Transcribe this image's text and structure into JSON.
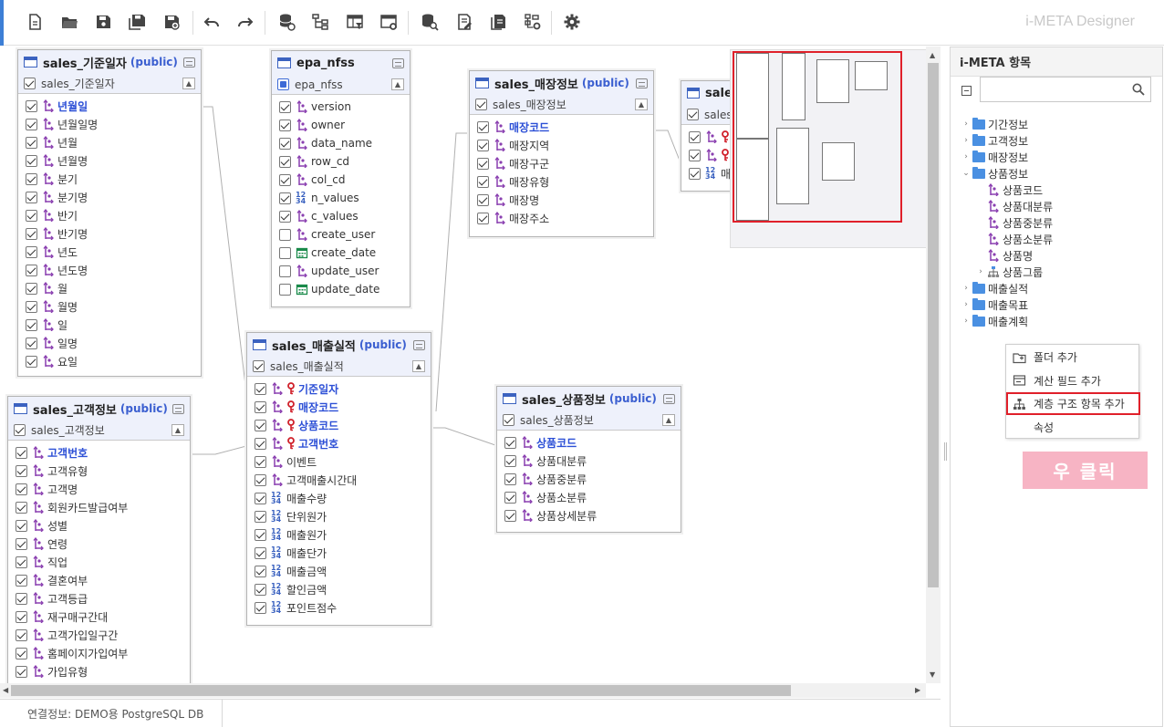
{
  "app": {
    "brand": "i-META Designer"
  },
  "toolbar": {
    "buttons": [
      {
        "name": "new-document",
        "icon": "new-document-icon"
      },
      {
        "name": "open-folder",
        "icon": "folder-open-icon"
      },
      {
        "name": "save",
        "icon": "save-icon"
      },
      {
        "name": "save-all",
        "icon": "save-all-icon"
      },
      {
        "name": "save-as",
        "icon": "save-as-icon"
      },
      {
        "name": "undo",
        "icon": "undo-icon"
      },
      {
        "name": "redo",
        "icon": "redo-icon"
      },
      {
        "name": "database-connect",
        "icon": "database-link-icon"
      },
      {
        "name": "hierarchy",
        "icon": "hierarchy-icon"
      },
      {
        "name": "table-filter",
        "icon": "table-filter-icon"
      },
      {
        "name": "table-settings",
        "icon": "table-settings-icon"
      },
      {
        "name": "database-search",
        "icon": "database-search-icon"
      },
      {
        "name": "document-edit",
        "icon": "document-edit-icon"
      },
      {
        "name": "document-copy",
        "icon": "document-copy-icon"
      },
      {
        "name": "tree-settings",
        "icon": "tree-settings-icon"
      },
      {
        "name": "settings",
        "icon": "gear-icon"
      }
    ]
  },
  "tables": {
    "date": {
      "name": "sales_기준일자",
      "schema": "(public)",
      "alias": "sales_기준일자",
      "fields": [
        {
          "label": "년월일",
          "type": "dim",
          "pk": true,
          "checked": true
        },
        {
          "label": "년월일명",
          "type": "dim",
          "checked": true
        },
        {
          "label": "년월",
          "type": "dim",
          "checked": true
        },
        {
          "label": "년월명",
          "type": "dim",
          "checked": true
        },
        {
          "label": "분기",
          "type": "dim",
          "checked": true
        },
        {
          "label": "분기명",
          "type": "dim",
          "checked": true
        },
        {
          "label": "반기",
          "type": "dim",
          "checked": true
        },
        {
          "label": "반기명",
          "type": "dim",
          "checked": true
        },
        {
          "label": "년도",
          "type": "dim",
          "checked": true
        },
        {
          "label": "년도명",
          "type": "dim",
          "checked": true
        },
        {
          "label": "월",
          "type": "dim",
          "checked": true
        },
        {
          "label": "월명",
          "type": "dim",
          "checked": true
        },
        {
          "label": "일",
          "type": "dim",
          "checked": true
        },
        {
          "label": "일명",
          "type": "dim",
          "checked": true
        },
        {
          "label": "요일",
          "type": "dim",
          "checked": true
        }
      ]
    },
    "nfss": {
      "name": "epa_nfss",
      "schema": "",
      "alias": "epa_nfss",
      "fields": [
        {
          "label": "version",
          "type": "dim",
          "checked": true
        },
        {
          "label": "owner",
          "type": "dim",
          "checked": true
        },
        {
          "label": "data_name",
          "type": "dim",
          "checked": true
        },
        {
          "label": "row_cd",
          "type": "dim",
          "checked": true
        },
        {
          "label": "col_cd",
          "type": "dim",
          "checked": true
        },
        {
          "label": "n_values",
          "type": "num",
          "checked": true
        },
        {
          "label": "c_values",
          "type": "dim",
          "checked": true
        },
        {
          "label": "create_user",
          "type": "dim",
          "checked": false
        },
        {
          "label": "create_date",
          "type": "date",
          "checked": false
        },
        {
          "label": "update_user",
          "type": "dim",
          "checked": false
        },
        {
          "label": "update_date",
          "type": "date",
          "checked": false
        }
      ]
    },
    "store": {
      "name": "sales_매장정보",
      "schema": "(public)",
      "alias": "sales_매장정보",
      "fields": [
        {
          "label": "매장코드",
          "type": "dim",
          "pk": true,
          "checked": true
        },
        {
          "label": "매장지역",
          "type": "dim",
          "checked": true
        },
        {
          "label": "매장구군",
          "type": "dim",
          "checked": true
        },
        {
          "label": "매장유형",
          "type": "dim",
          "checked": true
        },
        {
          "label": "매장명",
          "type": "dim",
          "checked": true
        },
        {
          "label": "매장주소",
          "type": "dim",
          "checked": true
        }
      ]
    },
    "partial": {
      "name": "sale",
      "alias": "sales",
      "fields": [
        {
          "label": "",
          "type": "dim",
          "key": true,
          "checked": true
        },
        {
          "label": "",
          "type": "dim",
          "key": true,
          "checked": true
        },
        {
          "label": "매",
          "type": "num",
          "checked": true
        }
      ]
    },
    "sales": {
      "name": "sales_매출실적",
      "schema": "(public)",
      "alias": "sales_매출실적",
      "fields": [
        {
          "label": "기준일자",
          "type": "dim",
          "key": true,
          "pk": true,
          "checked": true
        },
        {
          "label": "매장코드",
          "type": "dim",
          "key": true,
          "pk": true,
          "checked": true
        },
        {
          "label": "상품코드",
          "type": "dim",
          "key": true,
          "pk": true,
          "checked": true
        },
        {
          "label": "고객번호",
          "type": "dim",
          "key": true,
          "pk": true,
          "checked": true
        },
        {
          "label": "이벤트",
          "type": "dim",
          "checked": true
        },
        {
          "label": "고객매출시간대",
          "type": "dim",
          "checked": true
        },
        {
          "label": "매출수량",
          "type": "num",
          "checked": true
        },
        {
          "label": "단위원가",
          "type": "num",
          "checked": true
        },
        {
          "label": "매출원가",
          "type": "num",
          "checked": true
        },
        {
          "label": "매출단가",
          "type": "num",
          "checked": true
        },
        {
          "label": "매출금액",
          "type": "num",
          "checked": true
        },
        {
          "label": "할인금액",
          "type": "num",
          "checked": true
        },
        {
          "label": "포인트점수",
          "type": "num",
          "checked": true
        }
      ]
    },
    "customer": {
      "name": "sales_고객정보",
      "schema": "(public)",
      "alias": "sales_고객정보",
      "fields": [
        {
          "label": "고객번호",
          "type": "dim",
          "pk": true,
          "checked": true
        },
        {
          "label": "고객유형",
          "type": "dim",
          "checked": true
        },
        {
          "label": "고객명",
          "type": "dim",
          "checked": true
        },
        {
          "label": "회원카드발급여부",
          "type": "dim",
          "checked": true
        },
        {
          "label": "성별",
          "type": "dim",
          "checked": true
        },
        {
          "label": "연령",
          "type": "dim",
          "checked": true
        },
        {
          "label": "직업",
          "type": "dim",
          "checked": true
        },
        {
          "label": "결혼여부",
          "type": "dim",
          "checked": true
        },
        {
          "label": "고객등급",
          "type": "dim",
          "checked": true
        },
        {
          "label": "재구매구간대",
          "type": "dim",
          "checked": true
        },
        {
          "label": "고객가입일구간",
          "type": "dim",
          "checked": true
        },
        {
          "label": "홈페이지가입여부",
          "type": "dim",
          "checked": true
        },
        {
          "label": "가입유형",
          "type": "dim",
          "checked": true
        }
      ]
    },
    "product": {
      "name": "sales_상품정보",
      "schema": "(public)",
      "alias": "sales_상품정보",
      "fields": [
        {
          "label": "상품코드",
          "type": "dim",
          "pk": true,
          "checked": true
        },
        {
          "label": "상품대분류",
          "type": "dim",
          "checked": true
        },
        {
          "label": "상품중분류",
          "type": "dim",
          "checked": true
        },
        {
          "label": "상품소분류",
          "type": "dim",
          "checked": true
        },
        {
          "label": "상품상세분류",
          "type": "dim",
          "checked": true
        }
      ]
    }
  },
  "status": {
    "connection": "연결정보: DEMO용 PostgreSQL DB"
  },
  "panel": {
    "title": "i-META 항목",
    "search_value": "",
    "tree": [
      {
        "label": "기간정보",
        "kind": "folder",
        "caret": "›",
        "level": 0
      },
      {
        "label": "고객정보",
        "kind": "folder",
        "caret": "›",
        "level": 0
      },
      {
        "label": "매장정보",
        "kind": "folder",
        "caret": "›",
        "level": 0
      },
      {
        "label": "상품정보",
        "kind": "folder",
        "caret": "⌄",
        "level": 0
      },
      {
        "label": "상품코드",
        "kind": "dim",
        "caret": "",
        "level": 1
      },
      {
        "label": "상품대분류",
        "kind": "dim",
        "caret": "",
        "level": 1
      },
      {
        "label": "상품중분류",
        "kind": "dim",
        "caret": "",
        "level": 1
      },
      {
        "label": "상품소분류",
        "kind": "dim",
        "caret": "",
        "level": 1
      },
      {
        "label": "상품명",
        "kind": "dim",
        "caret": "",
        "level": 1
      },
      {
        "label": "상품그룹",
        "kind": "hier",
        "caret": "›",
        "level": 1
      },
      {
        "label": "매출실적",
        "kind": "folder",
        "caret": "›",
        "level": 0
      },
      {
        "label": "매출목표",
        "kind": "folder",
        "caret": "›",
        "level": 0
      },
      {
        "label": "매출계획",
        "kind": "folder",
        "caret": "›",
        "level": 0
      }
    ]
  },
  "context_menu": {
    "items": [
      {
        "label": "폴더 추가",
        "icon": "folder-add-icon"
      },
      {
        "label": "계산 필드 추가",
        "icon": "calc-field-icon"
      },
      {
        "label": "계층 구조 항목 추가",
        "icon": "hierarchy-icon",
        "highlighted": true
      },
      {
        "label": "속성",
        "icon": ""
      }
    ]
  },
  "callout": {
    "label": "우 클릭",
    "color": "#f7b4c4"
  },
  "colors": {
    "accent": "#3d7fd6",
    "pk_text": "#2c4fd6",
    "highlight": "#e0202a",
    "key_icon": "#d0202a",
    "dim_icon": "#8a3fb0"
  }
}
